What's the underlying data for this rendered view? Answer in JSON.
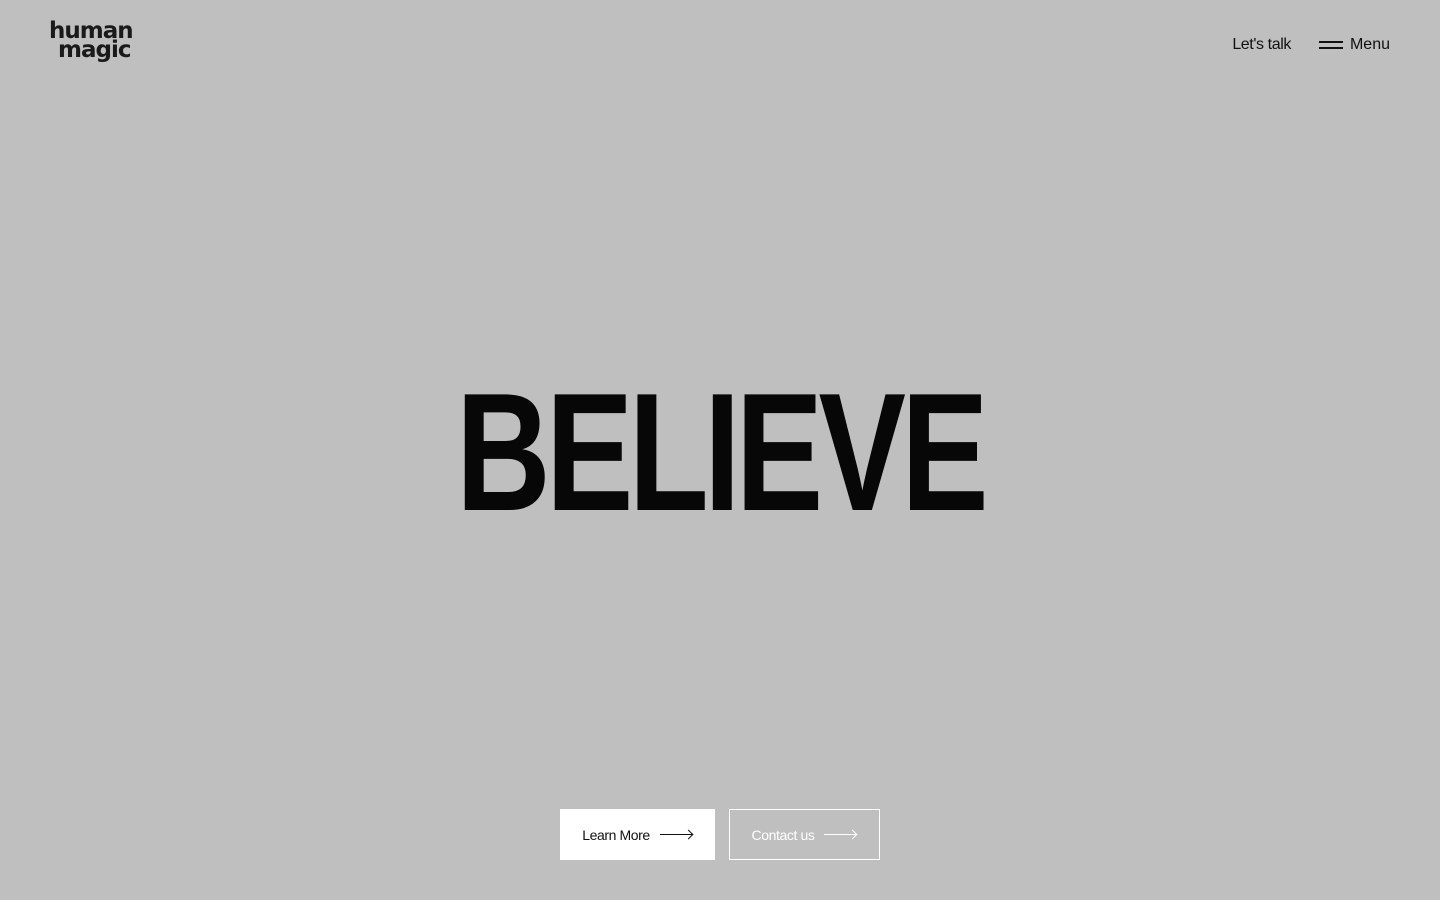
{
  "brand": {
    "logo_line1": "human",
    "logo_line2": "magic"
  },
  "nav": {
    "lets_talk": "Let's talk",
    "menu_label": "Menu",
    "menu_icon": "hamburger-icon"
  },
  "hero": {
    "headline": "BELIEVE"
  },
  "cta": {
    "primary_label": "Learn More",
    "secondary_label": "Contact us",
    "arrow_icon": "arrow-right-icon"
  },
  "colors": {
    "background": "#bfbfbf",
    "text": "#111111",
    "headline": "#070707",
    "button_primary_bg": "#ffffff",
    "button_secondary_border": "#ffffff"
  }
}
